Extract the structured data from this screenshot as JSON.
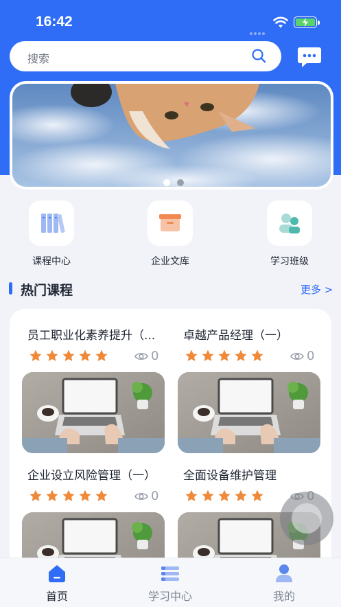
{
  "status_bar": {
    "time": "16:42"
  },
  "search": {
    "placeholder": "搜索"
  },
  "banner": {
    "pages": 2,
    "current_page": 1
  },
  "categories": [
    {
      "label": "课程中心",
      "icon": "books-icon"
    },
    {
      "label": "企业文库",
      "icon": "file-box-icon"
    },
    {
      "label": "学习班级",
      "icon": "class-group-icon"
    }
  ],
  "section": {
    "title": "热门课程",
    "more": "更多 >"
  },
  "courses": [
    {
      "title": "员工职业化素养提升（...",
      "rating": 5,
      "views": "0"
    },
    {
      "title": "卓越产品经理（一）",
      "rating": 5,
      "views": "0"
    },
    {
      "title": "企业设立风险管理（一）",
      "rating": 5,
      "views": "0"
    },
    {
      "title": "全面设备维护管理",
      "rating": 5,
      "views": "0"
    }
  ],
  "tabbar": {
    "items": [
      {
        "label": "首页",
        "icon": "home-icon",
        "active": true
      },
      {
        "label": "学习中心",
        "icon": "list-icon",
        "active": false
      },
      {
        "label": "我的",
        "icon": "user-icon",
        "active": false
      }
    ]
  },
  "colors": {
    "primary": "#2f6df6",
    "star": "#ef8a3a"
  }
}
